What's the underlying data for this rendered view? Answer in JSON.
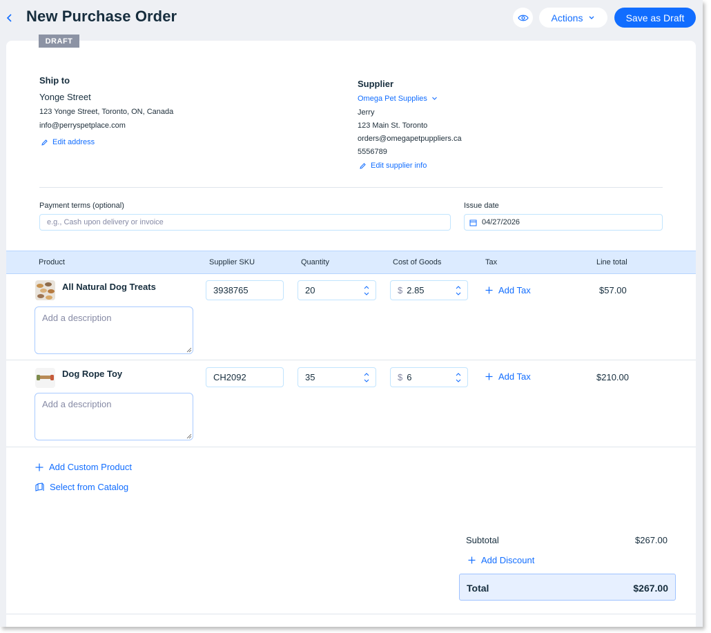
{
  "header": {
    "title": "New Purchase Order",
    "actions_label": "Actions",
    "save_label": "Save as Draft"
  },
  "status_badge": "DRAFT",
  "ship_to": {
    "heading": "Ship to",
    "name": "Yonge Street",
    "address": "123 Yonge Street, Toronto, ON, Canada",
    "email": "info@perryspetplace.com",
    "edit_label": "Edit address"
  },
  "supplier": {
    "heading": "Supplier",
    "name": "Omega Pet Supplies",
    "contact": "Jerry",
    "address": "123 Main St. Toronto",
    "email": "orders@omegapetpuppliers.ca",
    "phone": "5556789",
    "edit_label": "Edit supplier info"
  },
  "payment_terms": {
    "label": "Payment terms (optional)",
    "placeholder": "e.g., Cash upon delivery or invoice"
  },
  "issue_date": {
    "label": "Issue date",
    "value": "04/27/2026"
  },
  "table": {
    "columns": [
      "Product",
      "Supplier SKU",
      "Quantity",
      "Cost of Goods",
      "Tax",
      "Line total"
    ],
    "description_placeholder": "Add a description",
    "add_tax_label": "Add Tax",
    "currency_symbol": "$",
    "rows": [
      {
        "name": "All Natural Dog Treats",
        "sku": "3938765",
        "quantity": "20",
        "cost": "2.85",
        "line_total": "$57.00"
      },
      {
        "name": "Dog Rope Toy",
        "sku": "CH2092",
        "quantity": "35",
        "cost": "6",
        "line_total": "$210.00"
      }
    ]
  },
  "add_custom_product_label": "Add Custom Product",
  "select_catalog_label": "Select from Catalog",
  "summary": {
    "subtotal_label": "Subtotal",
    "subtotal_value": "$267.00",
    "add_discount_label": "Add Discount",
    "total_label": "Total",
    "total_value": "$267.00"
  },
  "colors": {
    "accent": "#116dff",
    "badge": "#8c93a4",
    "table_header": "#dcebff"
  }
}
